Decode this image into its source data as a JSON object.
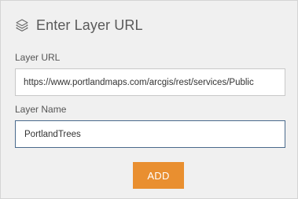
{
  "dialog": {
    "title": "Enter Layer URL",
    "icon": "layers-icon"
  },
  "layer_url": {
    "label": "Layer URL",
    "value": "https://www.portlandmaps.com/arcgis/rest/services/Public"
  },
  "layer_name": {
    "label": "Layer Name",
    "value": "PortlandTrees"
  },
  "actions": {
    "add_label": "ADD"
  },
  "colors": {
    "panel_background": "#f0f0f0",
    "button_accent": "#e98f30",
    "focused_border": "#4a6a8c",
    "title_text": "#5a5a5a"
  }
}
